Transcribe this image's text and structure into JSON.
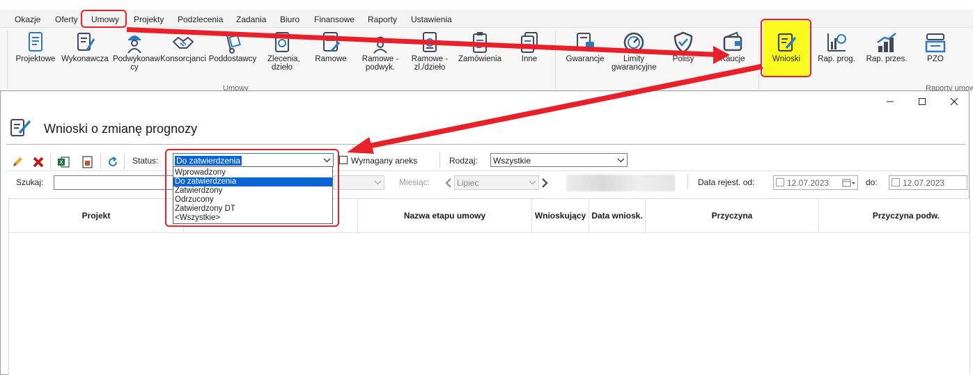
{
  "menu": {
    "items": [
      "Okazje",
      "Oferty",
      "Umowy",
      "Projekty",
      "Podzlecenia",
      "Zadania",
      "Biuro",
      "Finansowe",
      "Raporty",
      "Ustawienia"
    ]
  },
  "ribbon": {
    "buttons": [
      {
        "label": "Projektowe",
        "icon": "document-icon"
      },
      {
        "label": "Wykonawcza",
        "icon": "pen-document-icon"
      },
      {
        "label": "Podwykonaw cy",
        "icon": "worker-icon"
      },
      {
        "label": "Konsorcjanci",
        "icon": "handshake-icon"
      },
      {
        "label": "Poddostawcy",
        "icon": "hand-truck-icon"
      },
      {
        "label": "Zlecenia, dzieło",
        "icon": "sealed-document-icon"
      },
      {
        "label": "Ramowe",
        "icon": "frame-document-icon"
      },
      {
        "label": "Ramowe - podwyk.",
        "icon": "worker-helmet-icon"
      },
      {
        "label": "Ramowe - zl./dzieło",
        "icon": "sealed-frame-icon"
      },
      {
        "label": "Zamówienia",
        "icon": "clipboard-icon"
      },
      {
        "label": "Inne",
        "icon": "stack-documents-icon"
      },
      {
        "label": "Gwarancje",
        "icon": "guarantee-icon"
      },
      {
        "label": "Limity gwarancyjne",
        "icon": "gauge-icon"
      },
      {
        "label": "Polisy",
        "icon": "shield-icon"
      },
      {
        "label": "Kaucje",
        "icon": "wallet-icon"
      },
      {
        "label": "Wnioski",
        "icon": "edit-note-icon"
      },
      {
        "label": "Rap. prog.",
        "icon": "report-chart-icon"
      },
      {
        "label": "Rap. przes.",
        "icon": "bar-trend-icon"
      },
      {
        "label": "PZO",
        "icon": "inbox-tray-icon"
      }
    ],
    "group_umowy": "Umowy",
    "group_raporty": "Raporty umow"
  },
  "dialog": {
    "title": "Wnioski o zmianę prognozy",
    "status_label": "Status:",
    "status_value": "Do zatwierdzenia",
    "status_options": [
      "Wprowadzony",
      "Do zatwierdzenia",
      "Zatwierdzony",
      "Odrzucony",
      "Zatwierdzony DT",
      "<Wszystkie>"
    ],
    "aneks_label": "Wymagany aneks",
    "rodzaj_label": "Rodzaj:",
    "rodzaj_value": "Wszystkie",
    "search_label": "Szukaj:",
    "month_label": "Miesiąc:",
    "month_value": "Lipiec",
    "date_from_label": "Data rejest. od:",
    "date_from": "12.07.2023",
    "date_to_label": "do:",
    "date_to": "12.07.2023"
  },
  "grid": {
    "columns": [
      "Projekt",
      "Nazwa etapu umowy",
      "Wnioskujący",
      "Data wniosk.",
      "Przyczyna",
      "Przyczyna podw."
    ]
  },
  "colors": {
    "highlight_red": "#e8202a",
    "highlight_yellow": "#fafa1e",
    "selection_blue": "#0a64d6"
  }
}
